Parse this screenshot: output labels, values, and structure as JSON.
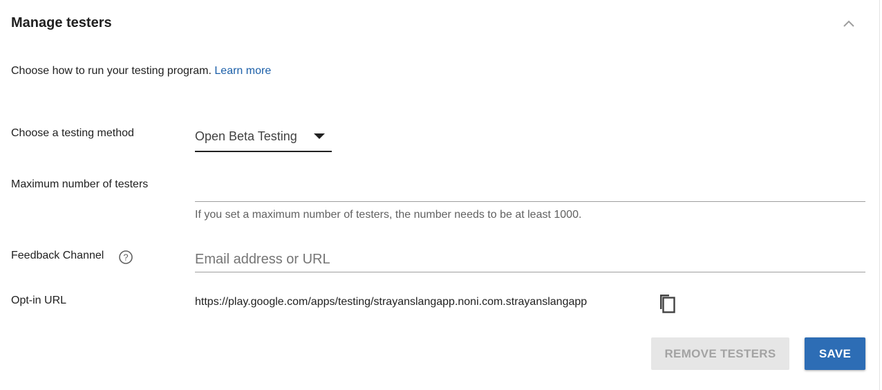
{
  "header": {
    "title": "Manage testers",
    "collapse_icon": "chevron-up-icon"
  },
  "intro": {
    "text": "Choose how to run your testing program.",
    "link": "Learn more"
  },
  "testing_method": {
    "label": "Choose a testing method",
    "selected": "Open Beta Testing",
    "icon": "dropdown-arrow-icon"
  },
  "max_testers": {
    "label": "Maximum number of testers",
    "value": "",
    "hint": "If you set a maximum number of testers, the number needs to be at least 1000."
  },
  "feedback": {
    "label": "Feedback Channel",
    "help_icon": "help-circle-icon",
    "value": "",
    "placeholder": "Email address or URL"
  },
  "opt_in": {
    "label": "Opt-in URL",
    "url": "https://play.google.com/apps/testing/strayanslangapp.noni.com.strayanslangapp",
    "copy_icon": "copy-icon"
  },
  "actions": {
    "remove_label": "REMOVE TESTERS",
    "save_label": "SAVE"
  },
  "colors": {
    "link": "#1a5ea8",
    "primary_button": "#2d6db5",
    "disabled_button_bg": "#e6e6e6",
    "disabled_button_text": "#a3a3a3"
  }
}
